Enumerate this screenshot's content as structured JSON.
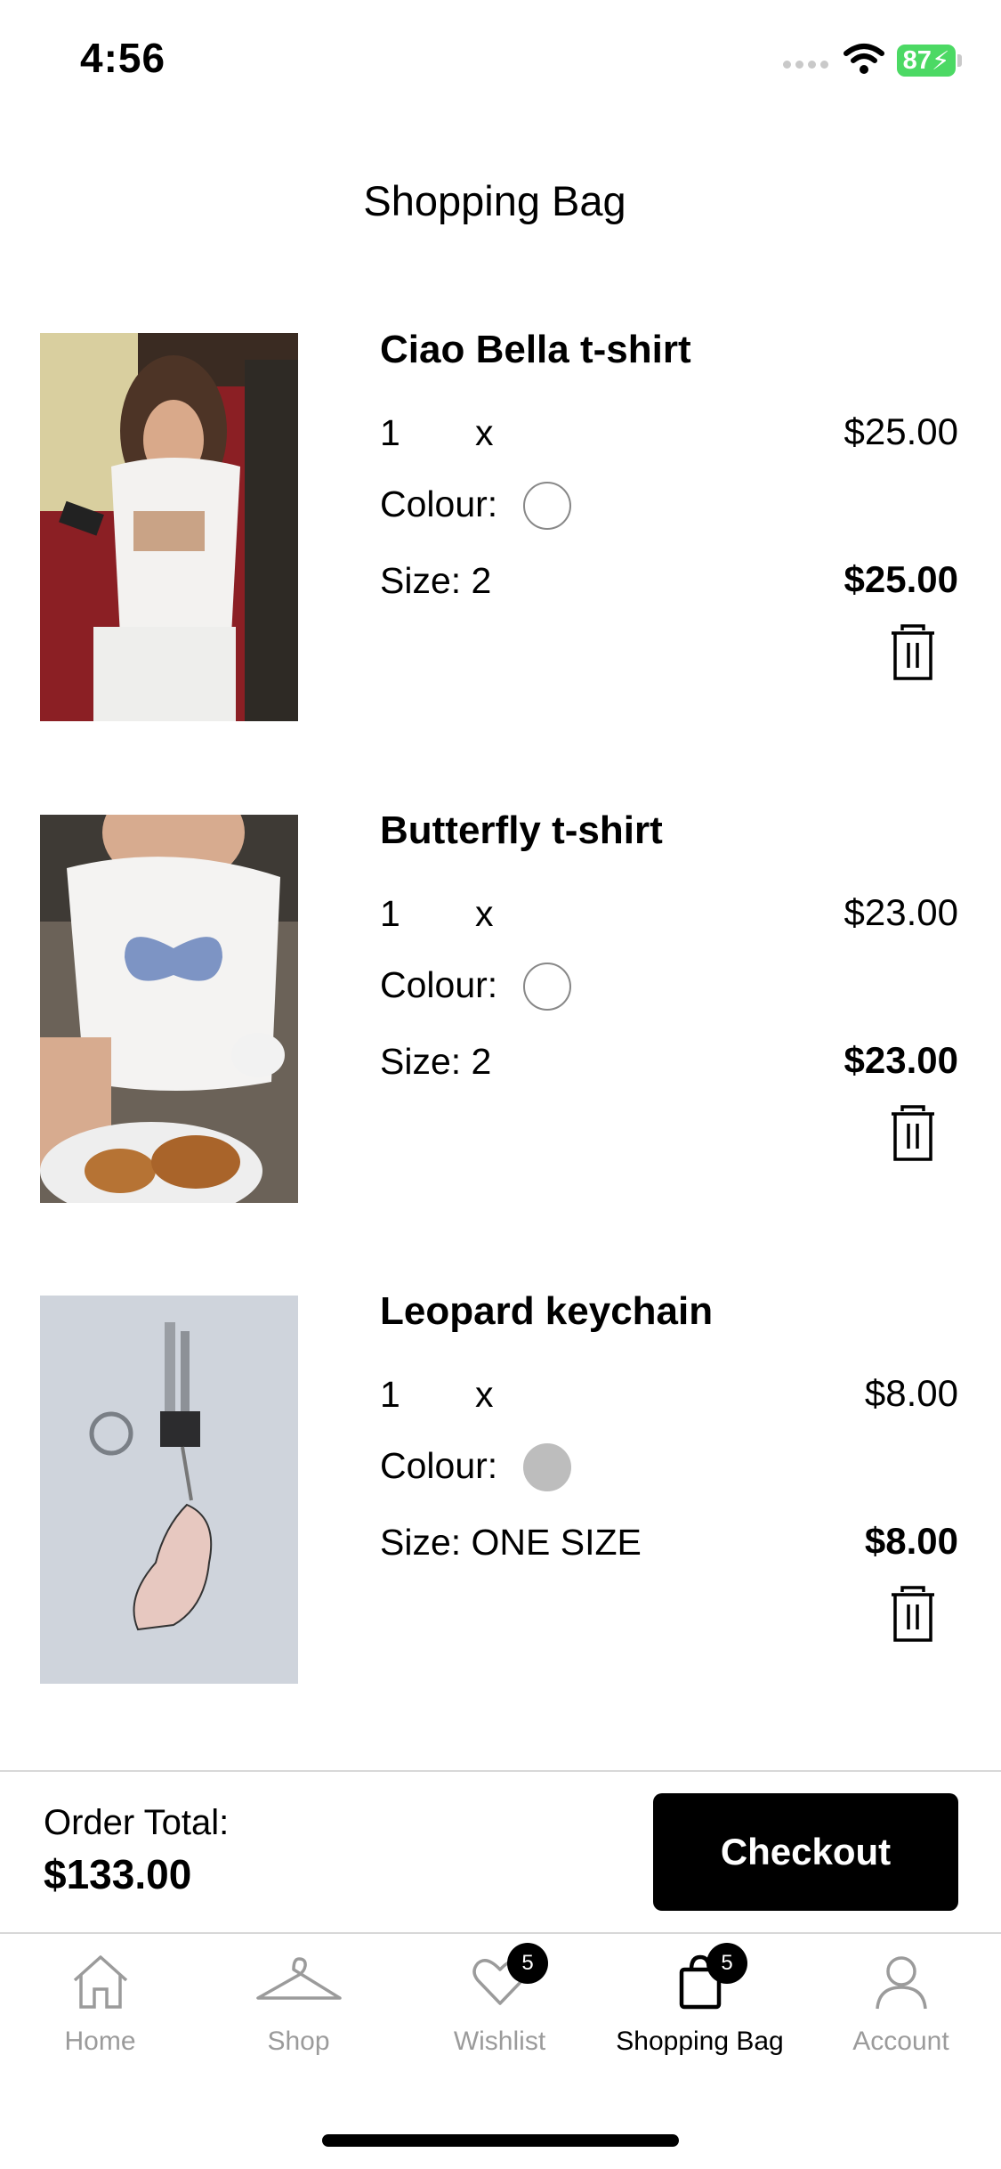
{
  "status_bar": {
    "time": "4:56",
    "battery": "87"
  },
  "header": {
    "title": "Shopping Bag"
  },
  "items": [
    {
      "name": "Ciao Bella t-shirt",
      "quantity": "1",
      "times": "x",
      "unit_price": "$25.00",
      "colour_label": "Colour:",
      "colour": "#ffffff",
      "size_label": "Size: 2",
      "line_total": "$25.00",
      "image": "woman-in-white-graphic-tee"
    },
    {
      "name": "Butterfly t-shirt",
      "quantity": "1",
      "times": "x",
      "unit_price": "$23.00",
      "colour_label": "Colour:",
      "colour": "#ffffff",
      "size_label": "Size: 2",
      "line_total": "$23.00",
      "image": "white-tee-with-blue-butterfly"
    },
    {
      "name": "Leopard keychain",
      "quantity": "1",
      "times": "x",
      "unit_price": "$8.00",
      "colour_label": "Colour:",
      "colour": "#bdbdbd",
      "size_label": "Size: ONE SIZE",
      "line_total": "$8.00",
      "image": "keys-with-leopard-keychain"
    }
  ],
  "footer": {
    "order_total_label": "Order Total:",
    "order_total_value": "$133.00",
    "checkout_label": "Checkout"
  },
  "tabs": [
    {
      "label": "Home",
      "icon": "home-icon",
      "badge": null
    },
    {
      "label": "Shop",
      "icon": "hanger-icon",
      "badge": null
    },
    {
      "label": "Wishlist",
      "icon": "heart-icon",
      "badge": "5"
    },
    {
      "label": "Shopping Bag",
      "icon": "bag-icon",
      "badge": "5",
      "active": true
    },
    {
      "label": "Account",
      "icon": "person-icon",
      "badge": null
    }
  ],
  "colors": {
    "accent": "#000000",
    "inactive_tab": "#9b9b9b",
    "battery": "#4cd964"
  }
}
